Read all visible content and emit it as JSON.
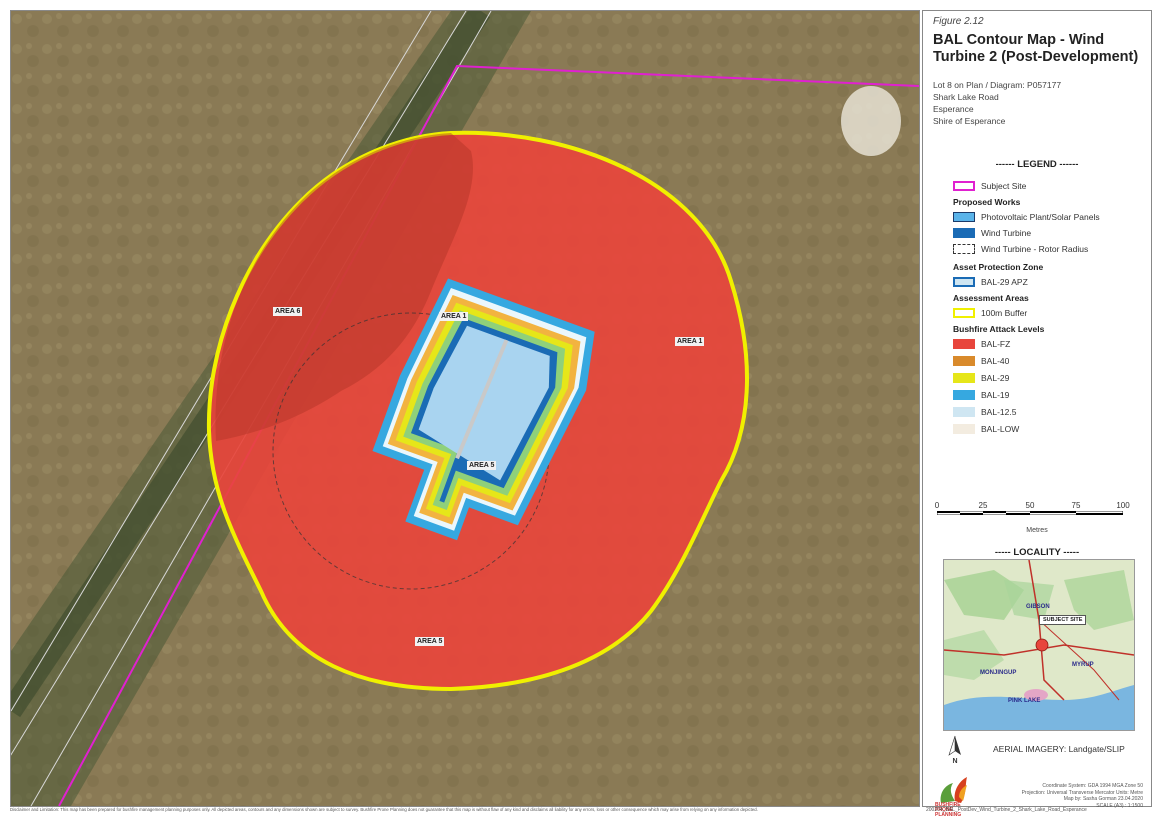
{
  "figure_number": "Figure 2.12",
  "title": "BAL Contour Map - Wind Turbine 2 (Post-Development)",
  "address": [
    "Lot 8 on Plan / Diagram: P057177",
    "Shark Lake Road",
    "Esperance",
    "Shire of Esperance"
  ],
  "map_labels": {
    "area_6": "AREA 6",
    "area_1_inner": "AREA 1",
    "area_1_outer": "AREA 1",
    "area_5_inner": "AREA 5",
    "area_5_outer": "AREA 5"
  },
  "legend": {
    "title": "------ LEGEND ------",
    "subject_site": "Subject Site",
    "proposed_works_heading": "Proposed Works",
    "photovoltaic": "Photovoltaic Plant/Solar Panels",
    "wind_turbine": "Wind Turbine",
    "rotor_radius": "Wind Turbine - Rotor Radius",
    "apz_heading": "Asset Protection Zone",
    "apz": "BAL-29 APZ",
    "assessment_heading": "Assessment Areas",
    "buffer": "100m Buffer",
    "bal_heading": "Bushfire Attack Levels",
    "bal_levels": [
      "BAL-FZ",
      "BAL-40",
      "BAL-29",
      "BAL-19",
      "BAL-12.5",
      "BAL-LOW"
    ]
  },
  "colors": {
    "bal_fz": "#e8453c",
    "bal_40": "#d98a2b",
    "bal_29": "#e6e619",
    "bal_19": "#36a8e0",
    "bal_12_5": "#cfe6f2",
    "bal_low": "#f3ece0",
    "subject_site": "#e020d0",
    "buffer": "#f0f000",
    "apz": "#1a6bb5"
  },
  "scale": {
    "ticks": [
      "0",
      "25",
      "50",
      "75",
      "100"
    ],
    "unit_label": "Metres"
  },
  "locality": {
    "title": "----- LOCALITY -----",
    "callout": "SUBJECT SITE",
    "places": [
      "GIBSON",
      "MONJINGUP",
      "MYRUP",
      "PINK LAKE"
    ]
  },
  "aerial_imagery": "AERIAL IMAGERY: Landgate/SLIP",
  "north_label": "N",
  "logo_text": "BUSHFIRE PRONE PLANNING",
  "coordinates": [
    "Coordinate System: GDA 1994 MGA Zone 50",
    "Projection: Universal Transverse Mercator  Units: Metre",
    "Map by: Sasha Gorman  23.04.2020",
    "SCALE (A3) : 1:1500"
  ],
  "disclaimer": "Disclaimer and Limitation: This map has been prepared for bushfire management planning purposes only. All depicted areas, contours and any dimensions shown are subject to survey. Bushfire Prone Planning does not guarantee that this map is without flaw of any kind and disclaims all liability for any errors, loss or other consequence which may arise from relying on any information depicted.",
  "file_name": "200204_BAL_PostDev_Wind_Turbine_2_Shark_Lake_Road_Esperance"
}
